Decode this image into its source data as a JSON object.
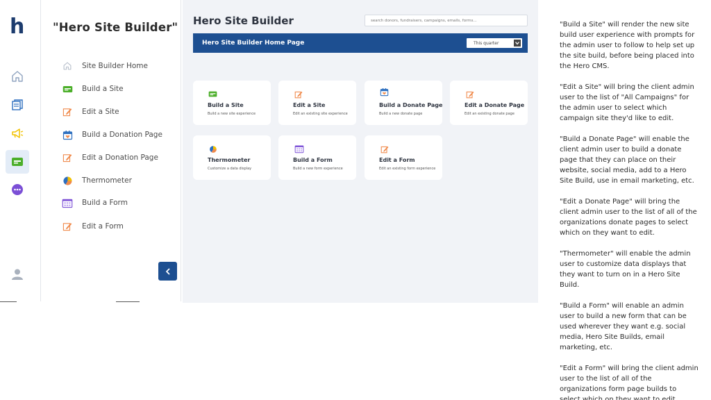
{
  "rail": {
    "logo": "h",
    "items": [
      "home-icon",
      "pages-icon",
      "megaphone-icon",
      "site-card-icon",
      "more-icon"
    ],
    "active": "site-card-icon",
    "bottom": "user-icon"
  },
  "menu": {
    "title": "\"Hero Site Builder\"",
    "items": [
      {
        "label": "Site Builder Home",
        "icon": "home-icon"
      },
      {
        "label": "Build a Site",
        "icon": "site-card-icon"
      },
      {
        "label": "Edit a Site",
        "icon": "edit-icon"
      },
      {
        "label": "Build a Donation Page",
        "icon": "donate-page-icon"
      },
      {
        "label": "Edit a Donation Page",
        "icon": "edit-icon"
      },
      {
        "label": "Thermometer",
        "icon": "thermometer-icon"
      },
      {
        "label": "Build a Form",
        "icon": "form-icon"
      },
      {
        "label": "Edit a Form",
        "icon": "edit-icon"
      }
    ]
  },
  "header": {
    "title": "Hero Site Builder",
    "search_placeholder": "search donors, fundraisers, campaigns, emails, forms..."
  },
  "banner": {
    "title": "Hero Site Builder Home Page",
    "period": "This quarter"
  },
  "cards": [
    {
      "title": "Build a Site",
      "subtitle": "Build a new site experience",
      "icon": "site-card-icon"
    },
    {
      "title": "Edit a Site",
      "subtitle": "Edit an existing site experience",
      "icon": "edit-icon"
    },
    {
      "title": "Build a Donate Page",
      "subtitle": "Build a new donate page",
      "icon": "donate-page-icon"
    },
    {
      "title": "Edit a Donate Page",
      "subtitle": "Edit an existing donate page",
      "icon": "edit-icon"
    },
    {
      "title": "Thermometer",
      "subtitle": "Customize a data display",
      "icon": "thermometer-icon"
    },
    {
      "title": "Build a Form",
      "subtitle": "Build a new form experience",
      "icon": "form-icon"
    },
    {
      "title": "Edit a Form",
      "subtitle": "Edit an existing form experience",
      "icon": "edit-icon"
    }
  ],
  "notes": [
    "\"Build a Site\" will render the new site build user experience with prompts for the admin user to follow to help set up the site build, before being placed into the Hero CMS.",
    "\"Edit a Site\" will bring the client admin user to the list of \"All Campaigns\" for the admin user to select which campaign site they'd like to edit.",
    "\"Build a Donate Page\" will enable the client admin user to build a donate page that they can place on their website, social media, add to a Hero Site Build, use in email marketing, etc.",
    "\"Edit a Donate Page\" will bring the client admin user to the list of all of the organizations donate pages to select which on they want to edit.",
    "\"Thermometer\" will enable the admin user to customize data displays that they want to turn on in a Hero Site Build.",
    "\"Build a Form\" will enable an admin user to build a new form that can be used wherever they want e.g. social media, Hero Site Builds, email marketing, etc.",
    "\"Edit a Form\" will bring the client admin user to the list of all of the organizations form page builds to select which on they want to edit."
  ],
  "colors": {
    "brand_blue": "#1d4f91",
    "logo_navy": "#1d3c6e",
    "icon_green": "#4caf2a",
    "icon_orange": "#f08a4b",
    "icon_purple": "#7b4fd6",
    "icon_yellow": "#f2c200"
  }
}
